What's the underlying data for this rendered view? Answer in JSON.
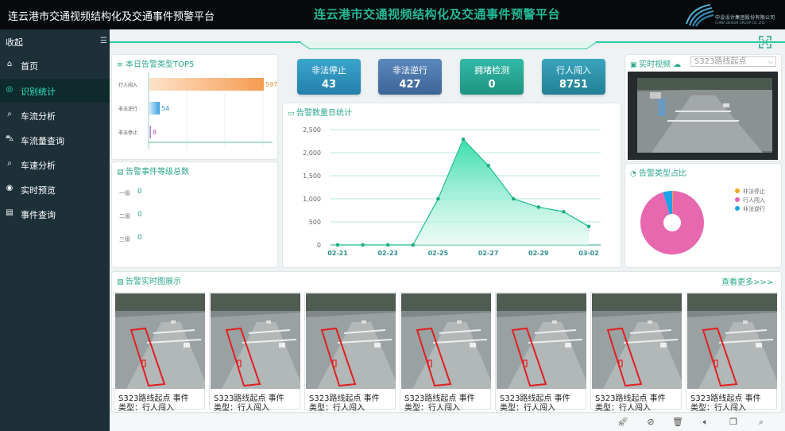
{
  "header": {
    "title": "连云港市交通视频结构化及交通事件预警平台",
    "logo_cn": "中设设计集团股份有限公司",
    "logo_en": "CHINA DESIGN GROUP CO.,LTD."
  },
  "sidebar": {
    "collapse_label": "收起",
    "items": [
      {
        "label": "首页",
        "icon": "home-icon"
      },
      {
        "label": "识别统计",
        "icon": "target-icon",
        "active": true
      },
      {
        "label": "车流分析",
        "icon": "search-car-icon"
      },
      {
        "label": "车流量查询",
        "icon": "car-icon"
      },
      {
        "label": "车速分析",
        "icon": "speed-icon"
      },
      {
        "label": "实时预览",
        "icon": "eye-icon"
      },
      {
        "label": "事件查询",
        "icon": "list-icon"
      }
    ]
  },
  "main_title": "连云港市交通视频结构化及交通事件预警平台",
  "top5": {
    "title": "本日告警类型TOP5",
    "chart_data": {
      "type": "bar",
      "categories": [
        "行人闯入",
        "非法逆行",
        "非法停止"
      ],
      "values": [
        597,
        54,
        8
      ],
      "xlim": [
        0,
        597
      ]
    }
  },
  "stats": [
    {
      "label": "非法停止",
      "value": "43",
      "color": "#2f8fb8"
    },
    {
      "label": "非法逆行",
      "value": "427",
      "color": "#4a76a8"
    },
    {
      "label": "拥堵检测",
      "value": "0",
      "color": "#27a898"
    },
    {
      "label": "行人闯入",
      "value": "8751",
      "color": "#2d93a8"
    }
  ],
  "video": {
    "title": "实时视频",
    "select_value": "S323路线起点"
  },
  "levels": {
    "title": "告警事件等级总数",
    "items": [
      {
        "label": "一级",
        "value": "0"
      },
      {
        "label": "二级",
        "value": "0"
      },
      {
        "label": "三级",
        "value": "0"
      }
    ]
  },
  "daily": {
    "title": "告警数量日统计",
    "chart_data": {
      "type": "area",
      "x": [
        "02-21",
        "02-22",
        "02-23",
        "02-24",
        "02-25",
        "02-26",
        "02-27",
        "02-28",
        "02-29",
        "03-01",
        "03-02"
      ],
      "x_tick_labels": [
        "02-21",
        "02-23",
        "02-25",
        "02-27",
        "02-29",
        "03-02"
      ],
      "values": [
        0,
        0,
        0,
        0,
        1000,
        2290,
        1720,
        1000,
        820,
        720,
        400
      ],
      "ylim": [
        0,
        2500
      ],
      "y_ticks": [
        "0",
        "500",
        "1,000",
        "1,500",
        "2,000",
        "2,500"
      ]
    }
  },
  "ratio": {
    "title": "告警类型占比",
    "chart_data": {
      "type": "pie",
      "categories": [
        "非法停止",
        "行人闯入",
        "非法逆行"
      ],
      "values": [
        43,
        8751,
        427
      ],
      "colors": [
        "#f5a623",
        "#e868b0",
        "#1aa3e8"
      ]
    }
  },
  "gallery": {
    "title": "告警实时图展示",
    "see_more": "查看更多>>>",
    "items": [
      {
        "cap1": "S323路线起点  事件",
        "cap2": "类型：行人闯入"
      },
      {
        "cap1": "S323路线起点  事件",
        "cap2": "类型：行人闯入"
      },
      {
        "cap1": "S323路线起点  事件",
        "cap2": "类型：行人闯入"
      },
      {
        "cap1": "S323路线起点  事件",
        "cap2": "类型：行人闯入"
      },
      {
        "cap1": "S323路线起点  事件",
        "cap2": "类型：行人闯入"
      },
      {
        "cap1": "S323路线起点  事件",
        "cap2": "类型：行人闯入"
      },
      {
        "cap1": "S323路线起点  事件",
        "cap2": "类型：行人闯入"
      }
    ]
  },
  "bottom_icons": [
    "rocket-icon",
    "compass-icon",
    "trash-icon",
    "volume-icon",
    "window-icon",
    "search-icon"
  ]
}
